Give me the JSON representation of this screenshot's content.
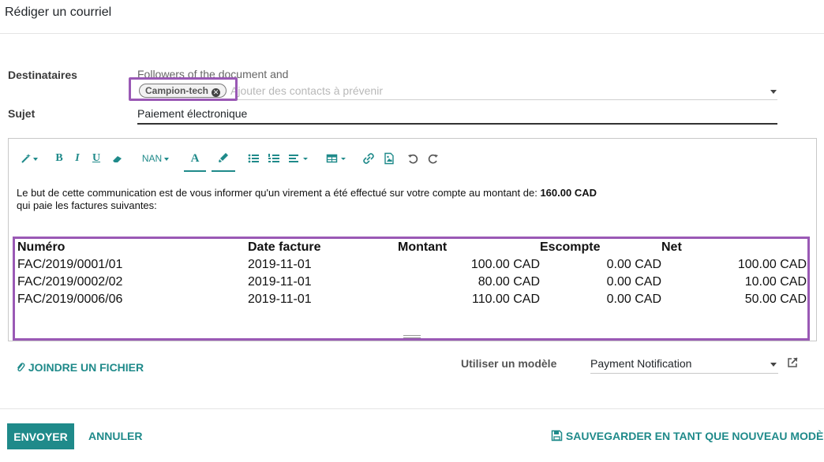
{
  "dialog": {
    "title": "Rédiger un courriel"
  },
  "recipients": {
    "label": "Destinataires",
    "followers_text": "Followers of the document and",
    "tags": [
      {
        "label": "Campion-tech"
      }
    ],
    "placeholder": "Ajouter des contacts à prévenir"
  },
  "subject": {
    "label": "Sujet",
    "value": "Paiement électronique"
  },
  "editor": {
    "toolbar": {
      "font_size_label": "NAN",
      "icons": [
        "magic-wand-icon",
        "bold-icon",
        "italic-icon",
        "underline-icon",
        "eraser-icon",
        "font-color-icon",
        "highlight-icon",
        "bullet-list-icon",
        "numbered-list-icon",
        "align-icon",
        "table-icon",
        "link-icon",
        "image-icon",
        "undo-icon",
        "redo-icon"
      ]
    },
    "body": {
      "line1": "Le but de cette communication est de vous informer qu'un virement a été effectué sur votre compte au montant de: ",
      "amount": "160.00 CAD",
      "line2": "qui paie les factures suivantes:"
    },
    "table": {
      "headers": [
        "Numéro",
        "Date facture",
        "Montant",
        "Escompte",
        "Net"
      ],
      "rows": [
        [
          "FAC/2019/0001/01",
          "2019-11-01",
          "100.00 CAD",
          "0.00 CAD",
          "100.00 CAD"
        ],
        [
          "FAC/2019/0002/02",
          "2019-11-01",
          "80.00 CAD",
          "0.00 CAD",
          "10.00 CAD"
        ],
        [
          "FAC/2019/0006/06",
          "2019-11-01",
          "110.00 CAD",
          "0.00 CAD",
          "50.00 CAD"
        ]
      ]
    }
  },
  "attach": {
    "label": "JOINDRE UN FICHIER"
  },
  "template": {
    "label": "Utiliser un modèle",
    "value": "Payment Notification"
  },
  "footer": {
    "send_label": "ENVOYER",
    "cancel_label": "ANNULER",
    "save_template_label": "SAUVEGARDER EN TANT QUE NOUVEAU MODÈLE"
  },
  "colors": {
    "accent": "#1f8a8a",
    "highlight": "#9a59b5"
  }
}
